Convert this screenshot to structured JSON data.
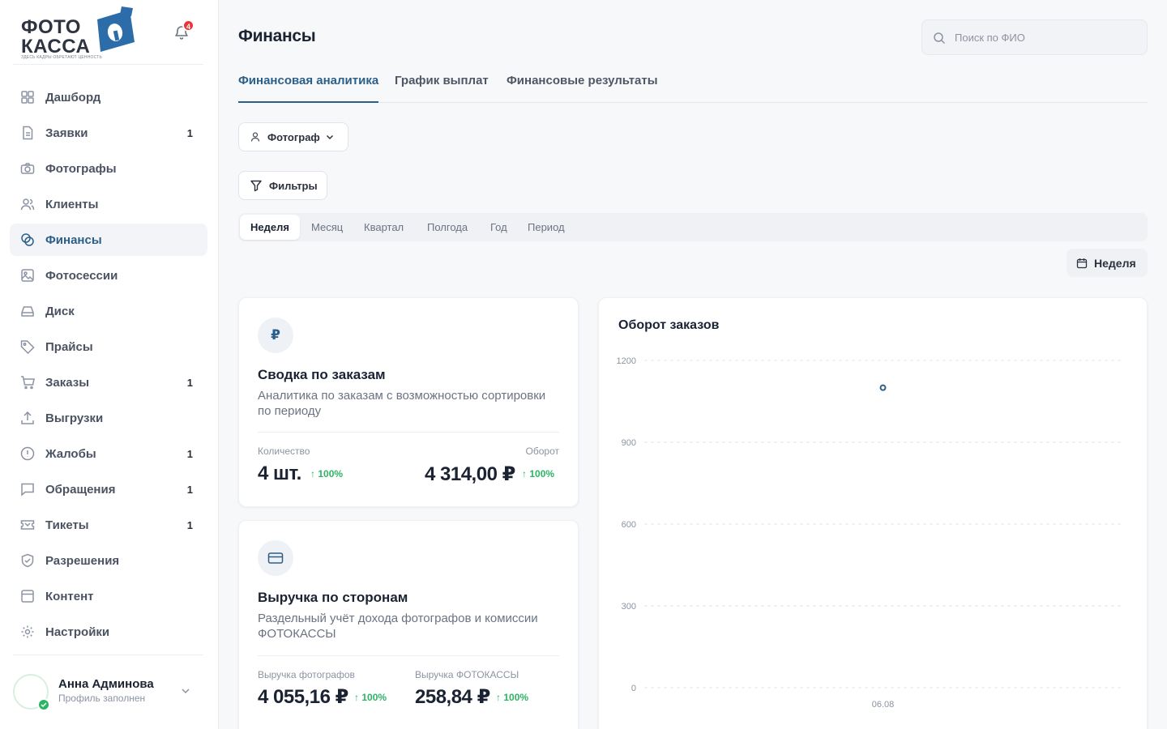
{
  "logo": {
    "line1": "ФОТО",
    "line2": "КАССА",
    "tagline": "ЗДЕСЬ КАДРЫ ОБРЕТАЮТ ЦЕННОСТЬ"
  },
  "notifications": {
    "count": "4"
  },
  "sidebar": {
    "items": [
      {
        "label": "Дашборд",
        "icon": "dashboard-icon",
        "count": ""
      },
      {
        "label": "Заявки",
        "icon": "document-icon",
        "count": "1"
      },
      {
        "label": "Фотографы",
        "icon": "camera-icon",
        "count": ""
      },
      {
        "label": "Клиенты",
        "icon": "users-icon",
        "count": ""
      },
      {
        "label": "Финансы",
        "icon": "coins-icon",
        "count": "",
        "active": true
      },
      {
        "label": "Фотосессии",
        "icon": "image-icon",
        "count": ""
      },
      {
        "label": "Диск",
        "icon": "disk-icon",
        "count": ""
      },
      {
        "label": "Прайсы",
        "icon": "tag-icon",
        "count": ""
      },
      {
        "label": "Заказы",
        "icon": "cart-icon",
        "count": "1"
      },
      {
        "label": "Выгрузки",
        "icon": "upload-icon",
        "count": ""
      },
      {
        "label": "Жалобы",
        "icon": "alert-icon",
        "count": "1"
      },
      {
        "label": "Обращения",
        "icon": "message-icon",
        "count": "1"
      },
      {
        "label": "Тикеты",
        "icon": "ticket-icon",
        "count": "1"
      },
      {
        "label": "Разрешения",
        "icon": "shield-icon",
        "count": ""
      },
      {
        "label": "Контент",
        "icon": "content-icon",
        "count": ""
      },
      {
        "label": "Настройки",
        "icon": "gear-icon",
        "count": ""
      }
    ]
  },
  "user": {
    "name": "Анна Админова",
    "status": "Профиль заполнен"
  },
  "header": {
    "title": "Финансы",
    "search_placeholder": "Поиск по ФИО"
  },
  "tabs": [
    {
      "label": "Финансовая аналитика",
      "active": true
    },
    {
      "label": "График выплат"
    },
    {
      "label": "Финансовые результаты"
    }
  ],
  "role_select": {
    "value": "Фотограф"
  },
  "filters": {
    "label": "Фильтры"
  },
  "periods": [
    {
      "label": "Неделя",
      "active": true
    },
    {
      "label": "Месяц"
    },
    {
      "label": "Квартал"
    },
    {
      "label": "Полгода"
    },
    {
      "label": "Год"
    },
    {
      "label": "Период"
    }
  ],
  "date_range": {
    "label": "Неделя"
  },
  "orders_card": {
    "icon_glyph": "₽",
    "title": "Сводка по заказам",
    "description": "Аналитика по заказам с возможностью сортировки по периоду",
    "qty_label": "Количество",
    "qty_value": "4 шт.",
    "qty_delta": "100%",
    "turnover_label": "Оборот",
    "turnover_value": "4 314,00 ₽",
    "turnover_delta": "100%"
  },
  "revenue_card": {
    "title": "Выручка по сторонам",
    "description": "Раздельный учёт дохода фотографов и комиссии ФОТОКАССЫ",
    "photographers_label": "Выручка фотографов",
    "photographers_value": "4 055,16 ₽",
    "photographers_delta": "100%",
    "platform_label": "Выручка ФОТОКАССЫ",
    "platform_value": "258,84 ₽",
    "platform_delta": "100%"
  },
  "chart_data": {
    "type": "scatter",
    "title": "Оборот заказов",
    "x": [
      "06.08"
    ],
    "series": [
      {
        "values": [
          1100
        ]
      }
    ],
    "ylim": [
      0,
      1200
    ],
    "yticks": [
      0,
      300,
      600,
      900,
      1200
    ],
    "grid": true,
    "color": "#2c5f88"
  }
}
